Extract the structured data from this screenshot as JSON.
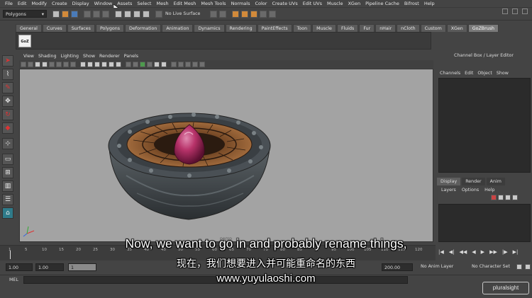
{
  "menubar": {
    "items": [
      "File",
      "Edit",
      "Modify",
      "Create",
      "Display",
      "Window",
      "Assets",
      "Select",
      "Mesh",
      "Edit Mesh",
      "Mesh Tools",
      "Normals",
      "Color",
      "Create UVs",
      "Edit UVs",
      "Muscle",
      "XGen",
      "Pipeline Cache",
      "Bifrost",
      "Help"
    ]
  },
  "statusline": {
    "menuset": "Polygons",
    "live_surface": "No Live Surface"
  },
  "shelf": {
    "tabs": [
      "General",
      "Curves",
      "Surfaces",
      "Polygons",
      "Deformation",
      "Animation",
      "Dynamics",
      "Rendering",
      "PaintEffects",
      "Toon",
      "Muscle",
      "Fluids",
      "Fur",
      "nHair",
      "nCloth",
      "Custom",
      "XGen",
      "GoZBrush"
    ],
    "active_tab": "GoZBrush",
    "goz_icon_label": "GoZ"
  },
  "viewport": {
    "menu": [
      "View",
      "Shading",
      "Lighting",
      "Show",
      "Renderer",
      "Panels"
    ],
    "camera_label": "persp"
  },
  "channel_box": {
    "title": "Channel Box / Layer Editor",
    "menu": [
      "Channels",
      "Edit",
      "Object",
      "Show"
    ]
  },
  "layer_editor": {
    "tabs": [
      "Display",
      "Render",
      "Anim"
    ],
    "active_tab": "Display",
    "menu": [
      "Layers",
      "Options",
      "Help"
    ]
  },
  "timeline": {
    "ticks": [
      "1",
      "5",
      "10",
      "15",
      "20",
      "25",
      "30",
      "35",
      "40",
      "45",
      "50",
      "55",
      "60",
      "65",
      "70",
      "75",
      "80",
      "85",
      "90",
      "95",
      "100",
      "105",
      "110",
      "115",
      "120"
    ]
  },
  "range": {
    "start": "1.00",
    "playback_start": "1.00",
    "range_slider_label": "1",
    "playback_end": "200.00",
    "anim_layer": "No Anim Layer",
    "character_set": "No Character Set"
  },
  "command_line": {
    "label": "MEL"
  },
  "subtitles": {
    "english": "Now, we want to go in and probably rename things,",
    "chinese": "现在，我们想要进入并可能重命名的东西",
    "url": "www.yuyulaoshi.com"
  },
  "watermark": {
    "brand": "pluralsight"
  },
  "colors": {
    "ui_bg": "#444444",
    "viewport_bg": "#a3a3a3",
    "gem": "#b8336a",
    "stone": "#4a5055",
    "wood": "#8a5a32"
  }
}
